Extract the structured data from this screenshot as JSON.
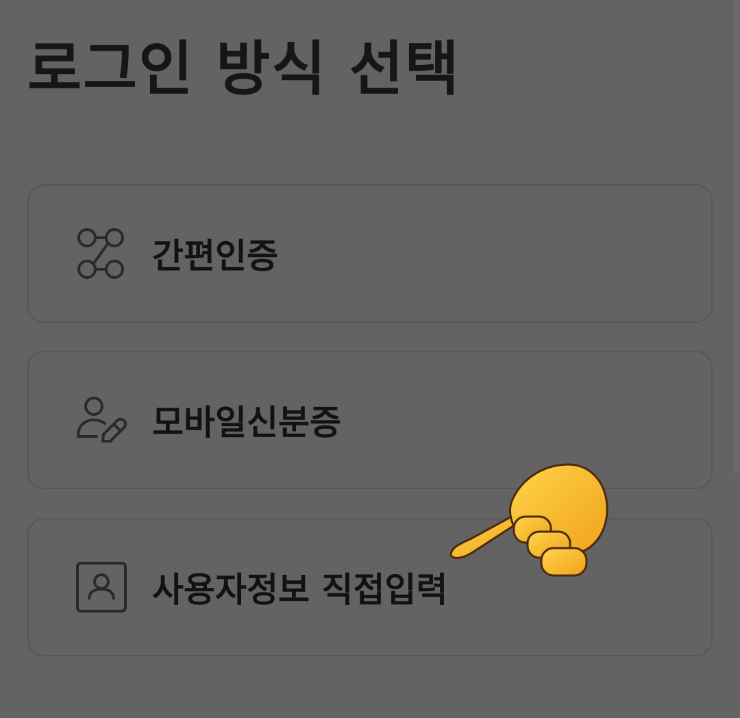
{
  "page": {
    "title": "로그인 방식 선택"
  },
  "options": [
    {
      "label": "간편인증",
      "icon": "share-nodes-icon"
    },
    {
      "label": "모바일신분증",
      "icon": "person-edit-icon"
    },
    {
      "label": "사용자정보 직접입력",
      "icon": "person-card-icon"
    }
  ],
  "colors": {
    "background": "#636363",
    "card_border": "#575757",
    "text": "#141414",
    "pointer": "#f5b32c"
  }
}
